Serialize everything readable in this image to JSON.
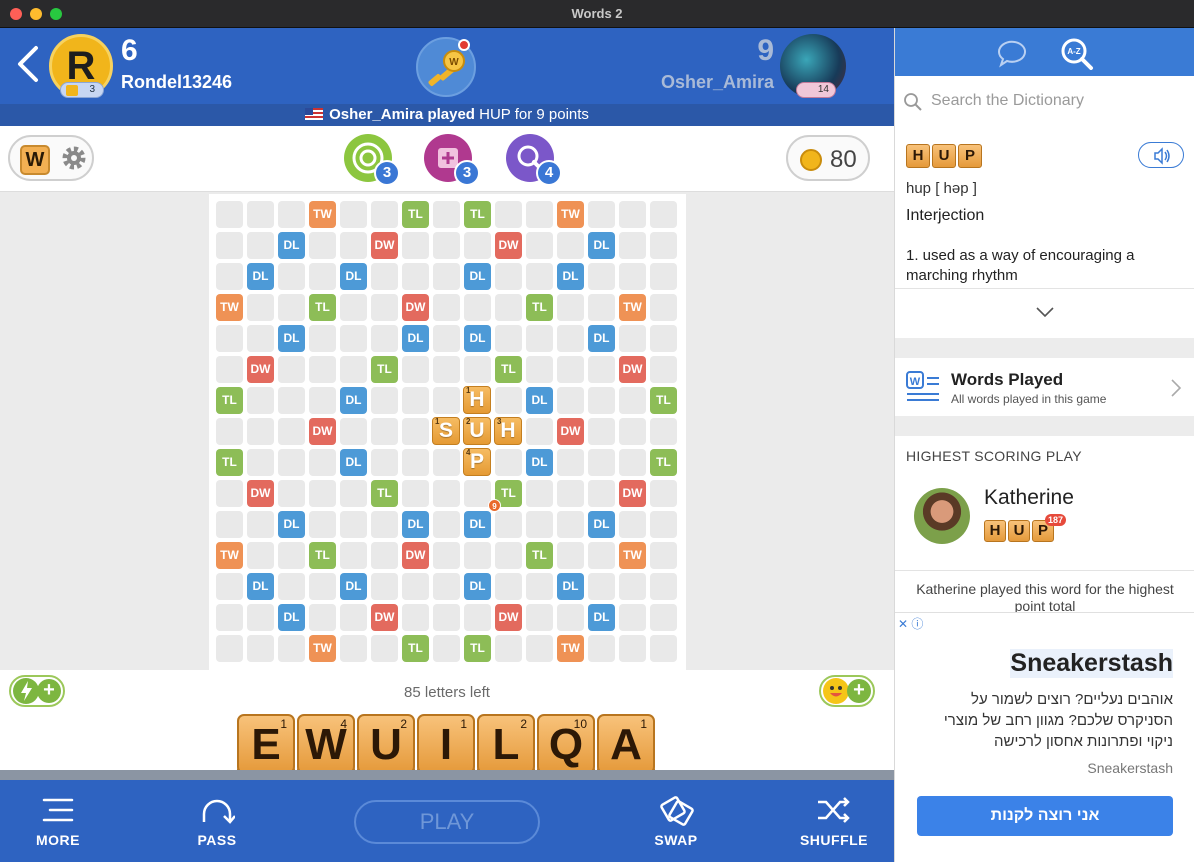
{
  "window": {
    "title": "Words 2"
  },
  "player1": {
    "initial": "R",
    "score": "6",
    "name": "Rondel13246",
    "level": "3"
  },
  "player2": {
    "score": "9",
    "name": "Osher_Amira",
    "level": "14"
  },
  "banner": {
    "player": "Osher_Amira played",
    "rest": " HUP for 9 points"
  },
  "powerups": [
    {
      "name": "swap-target",
      "count": "3",
      "color": "#8cc63f"
    },
    {
      "name": "tile-shuffle",
      "count": "3",
      "color": "#b0398f"
    },
    {
      "name": "word-finder",
      "count": "4",
      "color": "#7b57c9"
    }
  ],
  "coins": "80",
  "board": {
    "letters_left": "85 letters left",
    "placed": [
      {
        "row": 6,
        "col": 8,
        "letter": "H",
        "value": "1",
        "corner": "left"
      },
      {
        "row": 7,
        "col": 7,
        "letter": "S",
        "value": "1",
        "corner": "left"
      },
      {
        "row": 7,
        "col": 8,
        "letter": "U",
        "value": "2",
        "corner": "left"
      },
      {
        "row": 7,
        "col": 9,
        "letter": "H",
        "value": "3",
        "corner": "left"
      },
      {
        "row": 8,
        "col": 8,
        "letter": "P",
        "value": "4",
        "corner": "left"
      }
    ],
    "score_badge": "9",
    "premium": [
      "...TW..TL.TL..TW...",
      "..DL..DW...DW..DL..",
      ".DL..DL...DL..DL.",
      "TW..TL..DW...TL..TW",
      "..DL...DL.DL...DL..",
      ".DW...TL...TL...DW.",
      "TL...DL.....DL...TL",
      "...DW.......DW...",
      "TL...DL.....DL...TL",
      ".DW...TL...TL...DW.",
      "..DL...DL.DL...DL..",
      "TW..TL..DW...TL..TW",
      ".DL..DL...DL..DL.",
      "..DL..DW...DW..DL..",
      "...TW..TL.TL..TW..."
    ]
  },
  "rack": [
    {
      "letter": "E",
      "value": "1"
    },
    {
      "letter": "W",
      "value": "4"
    },
    {
      "letter": "U",
      "value": "2"
    },
    {
      "letter": "I",
      "value": "1"
    },
    {
      "letter": "L",
      "value": "2"
    },
    {
      "letter": "Q",
      "value": "10"
    },
    {
      "letter": "A",
      "value": "1"
    }
  ],
  "bottom": {
    "more": "MORE",
    "pass": "PASS",
    "play": "PLAY",
    "swap": "SWAP",
    "shuffle": "SHUFFLE"
  },
  "dictionary": {
    "search_placeholder": "Search the Dictionary",
    "word_tiles": [
      "H",
      "U",
      "P"
    ],
    "pronunciation": "hup [ həp ]",
    "part_of_speech": "Interjection",
    "definition": "1. used as a way of encouraging a marching rhythm"
  },
  "words_played": {
    "title": "Words Played",
    "subtitle": "All words played in this game"
  },
  "highest": {
    "heading": "HIGHEST SCORING PLAY",
    "name": "Katherine",
    "tiles": [
      "H",
      "U",
      "P"
    ],
    "score": "187",
    "description": "Katherine played this word for the highest point total"
  },
  "ad": {
    "title": "Sneakerstash",
    "text": "אוהבים נעליים? רוצים לשמור על הסניקרס שלכם? מגוון רחב של מוצרי ניקוי ופתרונות אחסון לרכישה",
    "brand": "Sneakerstash",
    "cta": "אני רוצה לקנות"
  },
  "colors": {
    "header_blue": "#2e63c1",
    "TW": "#ef9255",
    "DW": "#e36a5e",
    "TL": "#8dbd57",
    "DL": "#4d9ad7",
    "tile": "#f0a849"
  }
}
